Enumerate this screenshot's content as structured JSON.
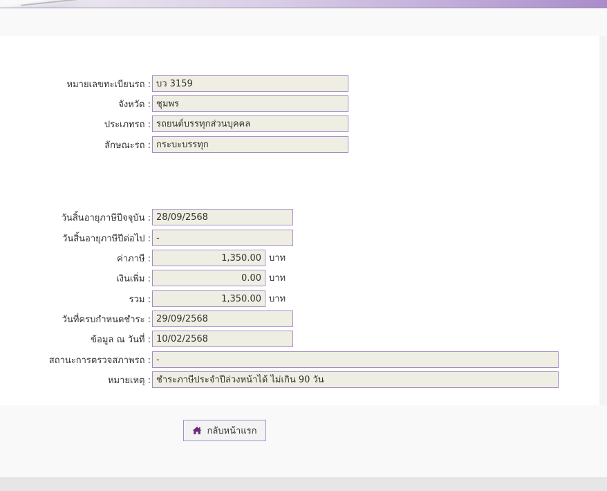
{
  "vehicle": {
    "plate_label": "หมายเลขทะเบียนรถ :",
    "plate_value": "บว 3159",
    "province_label": "จังหวัด :",
    "province_value": "ชุมพร",
    "type_label": "ประเภทรถ :",
    "type_value": "รถยนต์บรรทุกส่วนบุคคล",
    "body_label": "ลักษณะรถ :",
    "body_value": "กระบะบรรทุก"
  },
  "tax": {
    "current_expiry_label": "วันสิ้นอายุภาษีปีจจุบัน :",
    "current_expiry_value": "28/09/2568",
    "next_expiry_label": "วันสิ้นอายุภาษีปีต่อไป :",
    "next_expiry_value": "-",
    "tax_label": "ค่าภาษี :",
    "tax_value": "1,350.00",
    "surcharge_label": "เงินเพิ่ม :",
    "surcharge_value": "0.00",
    "total_label": "รวม :",
    "total_value": "1,350.00",
    "currency_unit": "บาท",
    "due_date_label": "วันที่ครบกำหนดชำระ :",
    "due_date_value": "29/09/2568",
    "data_as_of_label": "ข้อมูล ณ วันที่ :",
    "data_as_of_value": "10/02/2568",
    "inspection_label": "สถานะการตรวจสภาพรถ :",
    "inspection_value": "-",
    "remark_label": "หมายเหตุ :",
    "remark_value": "ชำระภาษีประจำปีล่วงหน้าได้ ไม่เกิน 90 วัน"
  },
  "actions": {
    "home_button_label": "กลับหน้าแรก",
    "home_icon": "home-icon"
  },
  "colors": {
    "field_bg": "#efeee2",
    "field_border": "#a58bc8",
    "icon_color": "#6a2c7a"
  }
}
